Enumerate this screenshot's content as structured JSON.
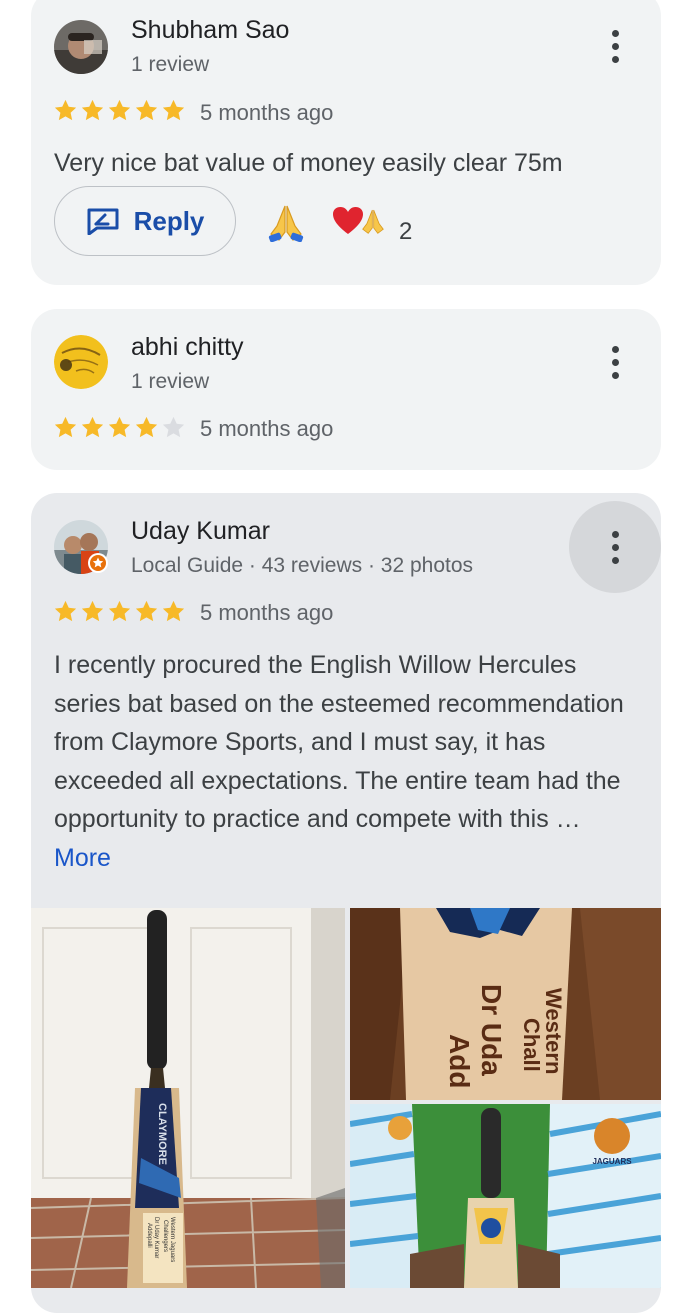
{
  "reviews": [
    {
      "name": "Shubham Sao",
      "meta": "1 review",
      "rating": 5,
      "time": "5 months ago",
      "text": "Very nice bat value of money easily clear 75m",
      "reply_label": "Reply",
      "reaction_count": "2"
    },
    {
      "name": "abhi chitty",
      "meta": "1 review",
      "rating": 4,
      "time": "5 months ago"
    },
    {
      "name": "Uday Kumar",
      "meta": "Local Guide · 43 reviews · 32 photos",
      "rating": 5,
      "time": "5 months ago",
      "text": "I recently procured the English Willow Hercules series bat based on the esteemed recommendation from Claymore Sports, and I must say, it has exceeded all expectations. The entire team had the opportunity to practice and compete with this … ",
      "more_label": "More",
      "photo_text": {
        "bat_brand": "CLAYMORE",
        "bat_sticker_line1": "Western Jaguars",
        "bat_sticker_line2": "Challengers",
        "bat_sticker_line3": "Dr Uday Kumar",
        "bat_sticker_line4": "Addepalli",
        "closeup_line1": "Western",
        "closeup_line2": "Chall",
        "closeup_line3": "Dr Uda",
        "closeup_line4": "Add",
        "jersey_badge": "JAGUARS"
      }
    }
  ],
  "colors": {
    "star_filled": "#f7b928",
    "star_empty": "#dadce0",
    "link": "#1a56c9",
    "reply": "#1a4da8"
  },
  "icons": [
    "more-vert-icon",
    "reply-icon",
    "folded-hands-emoji",
    "heart-emoji",
    "star-icon"
  ]
}
